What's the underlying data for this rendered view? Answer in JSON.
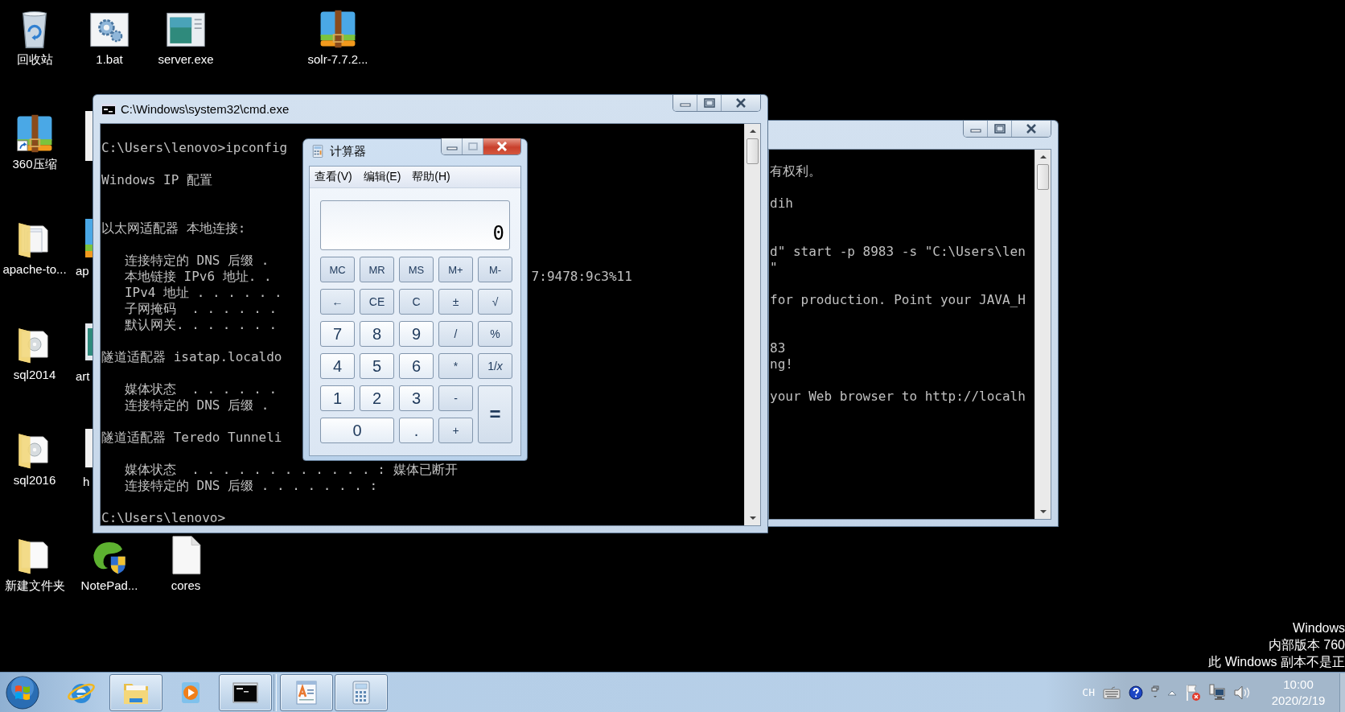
{
  "desktop_icons": [
    {
      "label": "回收站",
      "kind": "recycle-bin"
    },
    {
      "label": "1.bat",
      "kind": "batch"
    },
    {
      "label": "server.exe",
      "kind": "exe"
    },
    {
      "label": "solr-7.7.2...",
      "kind": "zip"
    },
    {
      "label": "360压缩",
      "kind": "zip-shortcut"
    },
    {
      "label": "apache-to...",
      "kind": "folder"
    },
    {
      "label": "sql2014",
      "kind": "folder-disc"
    },
    {
      "label": "sql2016",
      "kind": "folder-disc"
    },
    {
      "label": "新建文件夹",
      "kind": "folder-blank"
    },
    {
      "label": "NotePad...",
      "kind": "notepad"
    },
    {
      "label": "cores",
      "kind": "file"
    }
  ],
  "covered_icon_labels": [
    "ap",
    "art",
    "h"
  ],
  "cmd_window": {
    "title": "C:\\Windows\\system32\\cmd.exe",
    "lines": [
      {
        "kind": "text",
        "text": "C:\\Users\\lenovo>ipconfig"
      },
      {
        "kind": "blank"
      },
      {
        "kind": "text",
        "text": "Windows IP 配置"
      },
      {
        "kind": "blank"
      },
      {
        "kind": "blank"
      },
      {
        "kind": "text",
        "text": "以太网适配器 本地连接:"
      },
      {
        "kind": "blank"
      },
      {
        "kind": "text",
        "text": "   连接特定的 DNS 后缀 ."
      },
      {
        "kind": "text",
        "text": "   本地链接 IPv6 地址. .",
        "right": "7:9478:9c3%11"
      },
      {
        "kind": "text",
        "text": "   IPv4 地址 . . . . . ."
      },
      {
        "kind": "text",
        "text": "   子网掩码  . . . . . ."
      },
      {
        "kind": "text",
        "text": "   默认网关. . . . . . ."
      },
      {
        "kind": "blank"
      },
      {
        "kind": "text",
        "text": "隧道适配器 isatap.localdo"
      },
      {
        "kind": "blank"
      },
      {
        "kind": "text",
        "text": "   媒体状态  . . . . . ."
      },
      {
        "kind": "text",
        "text": "   连接特定的 DNS 后缀 ."
      },
      {
        "kind": "blank"
      },
      {
        "kind": "text",
        "text": "隧道适配器 Teredo Tunneli"
      },
      {
        "kind": "blank"
      },
      {
        "kind": "text",
        "text": "   媒体状态  . . . . . . . . . . . . : 媒体已断开"
      },
      {
        "kind": "text",
        "text": "   连接特定的 DNS 后缀 . . . . . . . :"
      },
      {
        "kind": "blank"
      },
      {
        "kind": "text",
        "text": "C:\\Users\\lenovo>"
      }
    ]
  },
  "back_window": {
    "lines": [
      {
        "kind": "text",
        "text": "有权利。"
      },
      {
        "kind": "blank"
      },
      {
        "kind": "text",
        "text": "dih"
      },
      {
        "kind": "blank"
      },
      {
        "kind": "blank"
      },
      {
        "kind": "text",
        "text": "d\" start -p 8983 -s \"C:\\Users\\len"
      },
      {
        "kind": "text",
        "text": "\""
      },
      {
        "kind": "blank"
      },
      {
        "kind": "text",
        "text": "for production. Point your JAVA_H"
      },
      {
        "kind": "blank"
      },
      {
        "kind": "blank"
      },
      {
        "kind": "text",
        "text": "83"
      },
      {
        "kind": "text",
        "text": "ng!"
      },
      {
        "kind": "blank"
      },
      {
        "kind": "text",
        "text": "your Web browser to http://localh"
      }
    ]
  },
  "calculator": {
    "title": "计算器",
    "menu": [
      "查看(V)",
      "编辑(E)",
      "帮助(H)"
    ],
    "display": "0",
    "buttons": [
      {
        "label": "MC",
        "kind": "memory"
      },
      {
        "label": "MR",
        "kind": "memory"
      },
      {
        "label": "MS",
        "kind": "memory"
      },
      {
        "label": "M+",
        "kind": "memory"
      },
      {
        "label": "M-",
        "kind": "memory"
      },
      {
        "label": "←",
        "kind": "function"
      },
      {
        "label": "CE",
        "kind": "function"
      },
      {
        "label": "C",
        "kind": "function"
      },
      {
        "label": "±",
        "kind": "function"
      },
      {
        "label": "√",
        "kind": "function"
      },
      {
        "label": "7",
        "kind": "digit"
      },
      {
        "label": "8",
        "kind": "digit"
      },
      {
        "label": "9",
        "kind": "digit"
      },
      {
        "label": "/",
        "kind": "function"
      },
      {
        "label": "%",
        "kind": "function"
      },
      {
        "label": "4",
        "kind": "digit"
      },
      {
        "label": "5",
        "kind": "digit"
      },
      {
        "label": "6",
        "kind": "digit"
      },
      {
        "label": "*",
        "kind": "function"
      },
      {
        "label": "1/*x*",
        "kind": "function"
      },
      {
        "label": "1",
        "kind": "digit"
      },
      {
        "label": "2",
        "kind": "digit"
      },
      {
        "label": "3",
        "kind": "digit"
      },
      {
        "label": "-",
        "kind": "function"
      },
      {
        "label": "=",
        "kind": "equals"
      },
      {
        "label": "0",
        "kind": "zero"
      },
      {
        "label": ".",
        "kind": "digit"
      },
      {
        "label": "+",
        "kind": "function"
      }
    ]
  },
  "os_notice": [
    "Windows",
    "内部版本 760",
    "此 Windows 副本不是正"
  ],
  "taskbar": {
    "items": [
      {
        "kind": "ie",
        "running": false
      },
      {
        "kind": "explorer",
        "running": true
      },
      {
        "kind": "media-player",
        "running": false
      },
      {
        "kind": "cmd",
        "running": true
      },
      {
        "kind": "wordpad",
        "running": true
      },
      {
        "kind": "calculator",
        "running": true
      }
    ],
    "input_language": "CH",
    "clock": {
      "time": "10:00",
      "date": "2020/2/19"
    }
  }
}
